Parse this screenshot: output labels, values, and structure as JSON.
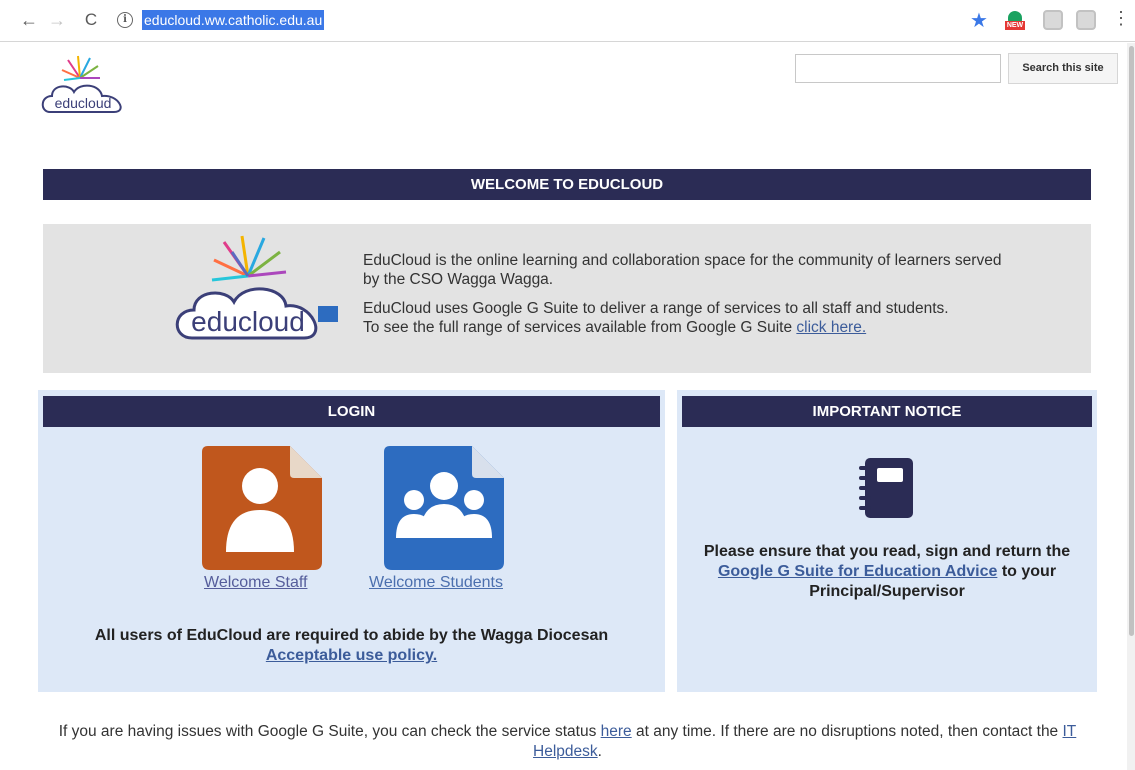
{
  "browser": {
    "url": "educloud.ww.catholic.edu.au",
    "back_glyph": "←",
    "forward_glyph": "→",
    "reload_glyph": "C",
    "info_glyph": "i",
    "star_glyph": "★",
    "menu_glyph": "⋮",
    "extension_badge": "NEW"
  },
  "site": {
    "logo_text": "educloud"
  },
  "search": {
    "button_label": "Search this site",
    "value": ""
  },
  "welcome": {
    "title": "WELCOME TO EDUCLOUD",
    "logo_text": "educloud",
    "para1": "EduCloud is the online learning and collaboration space for the community of learners served by the CSO Wagga Wagga.",
    "para2": "EduCloud uses Google G Suite to deliver a range of services to all staff and students.",
    "para3_prefix": "To see the full range of services available from Google G Suite ",
    "para3_link": "click here."
  },
  "login": {
    "title": "LOGIN",
    "staff_label": "Welcome Staff",
    "students_label": "Welcome Students",
    "policy_text": "All users of EduCloud are required to abide by the Wagga Diocesan",
    "policy_link": "Acceptable use policy."
  },
  "notice": {
    "title": "IMPORTANT NOTICE",
    "text_before": "Please ensure that you read, sign and return the",
    "link": " Google G Suite for Education Advice",
    "text_after": " to your Principal/Supervisor"
  },
  "footer": {
    "text_before": "If you are having issues with Google G Suite, you can check the service status ",
    "link1": "here",
    "text_middle": " at any time. If there are no disruptions noted, then contact the ",
    "link2": "IT Helpdesk",
    "text_after": "."
  },
  "colors": {
    "header_bar": "#2b2c55",
    "panel_bg": "#dde8f7",
    "intro_bg": "#e3e3e3",
    "staff_tile": "#c0571d",
    "students_tile": "#2d6cc0",
    "link": "#3c5c9a",
    "url_highlight": "#3b78e7"
  },
  "icons": {
    "back": "back-arrow-icon",
    "forward": "forward-arrow-icon",
    "reload": "reload-icon",
    "info": "info-icon",
    "bookmark": "bookmark-star-icon",
    "staff": "person-icon",
    "students": "group-icon",
    "notice": "notebook-icon"
  }
}
